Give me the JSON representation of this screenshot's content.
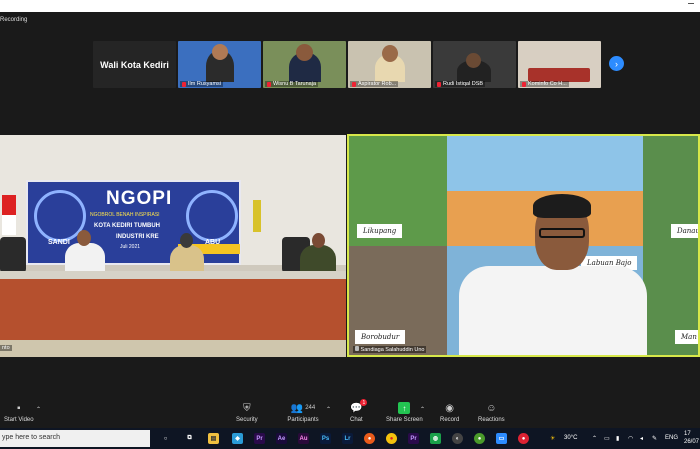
{
  "window": {
    "recording_label": "Recording"
  },
  "gallery": {
    "tiles": [
      {
        "name": "Wali Kota Kediri",
        "name_only": true
      },
      {
        "name": "Ilm Rusyamsi",
        "muted": true
      },
      {
        "name": "Wisnu B Tarunaja",
        "muted": true
      },
      {
        "name": "Aspirator Rob...",
        "muted": true
      },
      {
        "name": "Rudi Istiqal DSB",
        "muted": true
      },
      {
        "name": "Kominfo Co H...",
        "muted": true
      }
    ],
    "next_icon": "›"
  },
  "left_video": {
    "banner_title": "NGOPI",
    "banner_subtitle": "NGOBROL BENAH INSPIRASI",
    "banner_line1": "KOTA KEDIRI TUMBUH",
    "banner_line2": "INDUSTRI KRE",
    "banner_date": "Juli 2021",
    "left_name_tag": "SANDI",
    "right_name_tag": "ABU",
    "participant_label": "nto"
  },
  "right_video": {
    "tags": [
      "Likupang",
      "Danau",
      "Labuan Bajo",
      "Borobudur",
      "Man"
    ],
    "participant_label": "Sandiaga Salahuddin Uno",
    "colors": {
      "active_border": "#d7e84a"
    }
  },
  "toolbar": {
    "start_video": "Start Video",
    "security": "Security",
    "participants": "Participants",
    "participants_count": "244",
    "chat": "Chat",
    "chat_badge": "1",
    "share_screen": "Share Screen",
    "record": "Record",
    "reactions": "Reactions"
  },
  "taskbar": {
    "search_placeholder": "ype here to search",
    "temperature": "30°C",
    "language": "ENG",
    "time": "17",
    "date": "26/07"
  }
}
